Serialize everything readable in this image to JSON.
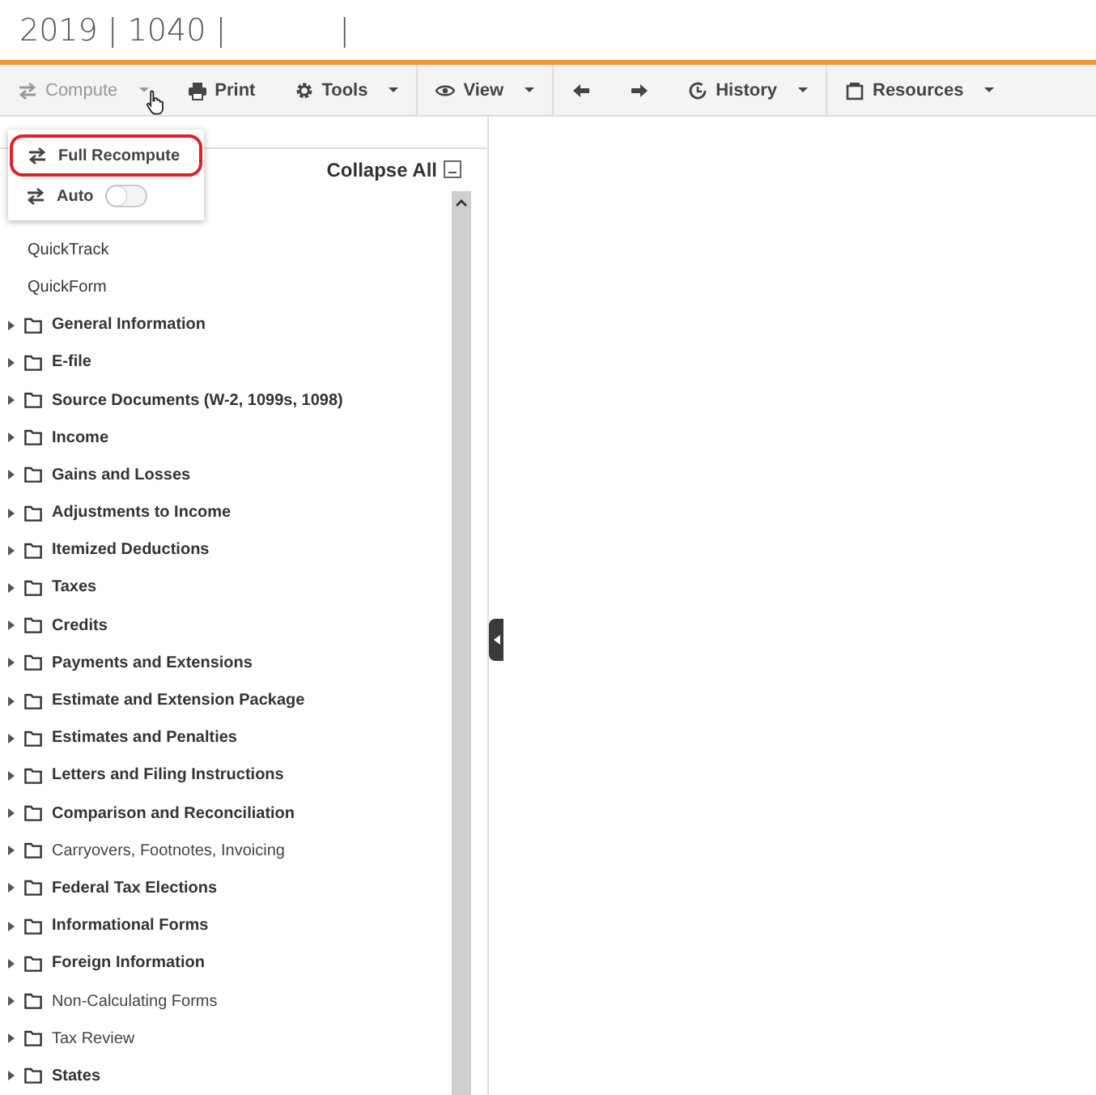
{
  "title": {
    "parts": [
      "2019 | 1040 |",
      "|"
    ]
  },
  "toolbar": {
    "groups": [
      [
        {
          "kind": "labeled",
          "label": "Compute",
          "caret": true,
          "disabled": true
        },
        {
          "kind": "labeled",
          "label": "Print",
          "caret": false,
          "disabled": false
        },
        {
          "kind": "labeled",
          "label": "Tools",
          "caret": true,
          "disabled": false
        }
      ],
      [
        {
          "kind": "labeled",
          "label": "View",
          "caret": true,
          "disabled": false
        }
      ],
      [
        {
          "kind": "icon_only",
          "caret": false,
          "disabled": false
        },
        {
          "kind": "icon_only",
          "caret": false,
          "disabled": false
        },
        {
          "kind": "labeled",
          "label": "History",
          "caret": true,
          "disabled": false
        }
      ],
      [
        {
          "kind": "labeled",
          "label": "Resources",
          "caret": true,
          "disabled": false
        }
      ]
    ]
  },
  "compute_menu": {
    "items": [
      {
        "kind": "action",
        "label": "Full Recompute",
        "highlighted": true
      },
      {
        "kind": "toggle",
        "label": "Auto",
        "on": false
      }
    ]
  },
  "organizer": {
    "collapse_all": "Collapse All",
    "links": [
      "QuickTrack",
      "QuickForm"
    ],
    "folders": [
      {
        "label": "General Information",
        "bold": true,
        "expanded": false
      },
      {
        "label": "E-file",
        "bold": true,
        "expanded": false
      },
      {
        "label": "Source Documents (W-2, 1099s, 1098)",
        "bold": true,
        "expanded": false
      },
      {
        "label": "Income",
        "bold": true,
        "expanded": false
      },
      {
        "label": "Gains and Losses",
        "bold": true,
        "expanded": false
      },
      {
        "label": "Adjustments to Income",
        "bold": true,
        "expanded": false
      },
      {
        "label": "Itemized Deductions",
        "bold": true,
        "expanded": false
      },
      {
        "label": "Taxes",
        "bold": true,
        "expanded": false
      },
      {
        "label": "Credits",
        "bold": true,
        "expanded": false
      },
      {
        "label": "Payments and Extensions",
        "bold": true,
        "expanded": false
      },
      {
        "label": "Estimate and Extension Package",
        "bold": true,
        "expanded": false
      },
      {
        "label": "Estimates and Penalties",
        "bold": true,
        "expanded": false
      },
      {
        "label": "Letters and Filing Instructions",
        "bold": true,
        "expanded": false
      },
      {
        "label": "Comparison and Reconciliation",
        "bold": true,
        "expanded": false
      },
      {
        "label": "Carryovers, Footnotes, Invoicing",
        "bold": false,
        "expanded": false
      },
      {
        "label": "Federal Tax Elections",
        "bold": true,
        "expanded": false
      },
      {
        "label": "Informational Forms",
        "bold": true,
        "expanded": false
      },
      {
        "label": "Foreign Information",
        "bold": true,
        "expanded": false
      },
      {
        "label": "Non-Calculating Forms",
        "bold": false,
        "expanded": false
      },
      {
        "label": "Tax Review",
        "bold": false,
        "expanded": false
      },
      {
        "label": "States",
        "bold": true,
        "expanded": false
      }
    ]
  }
}
